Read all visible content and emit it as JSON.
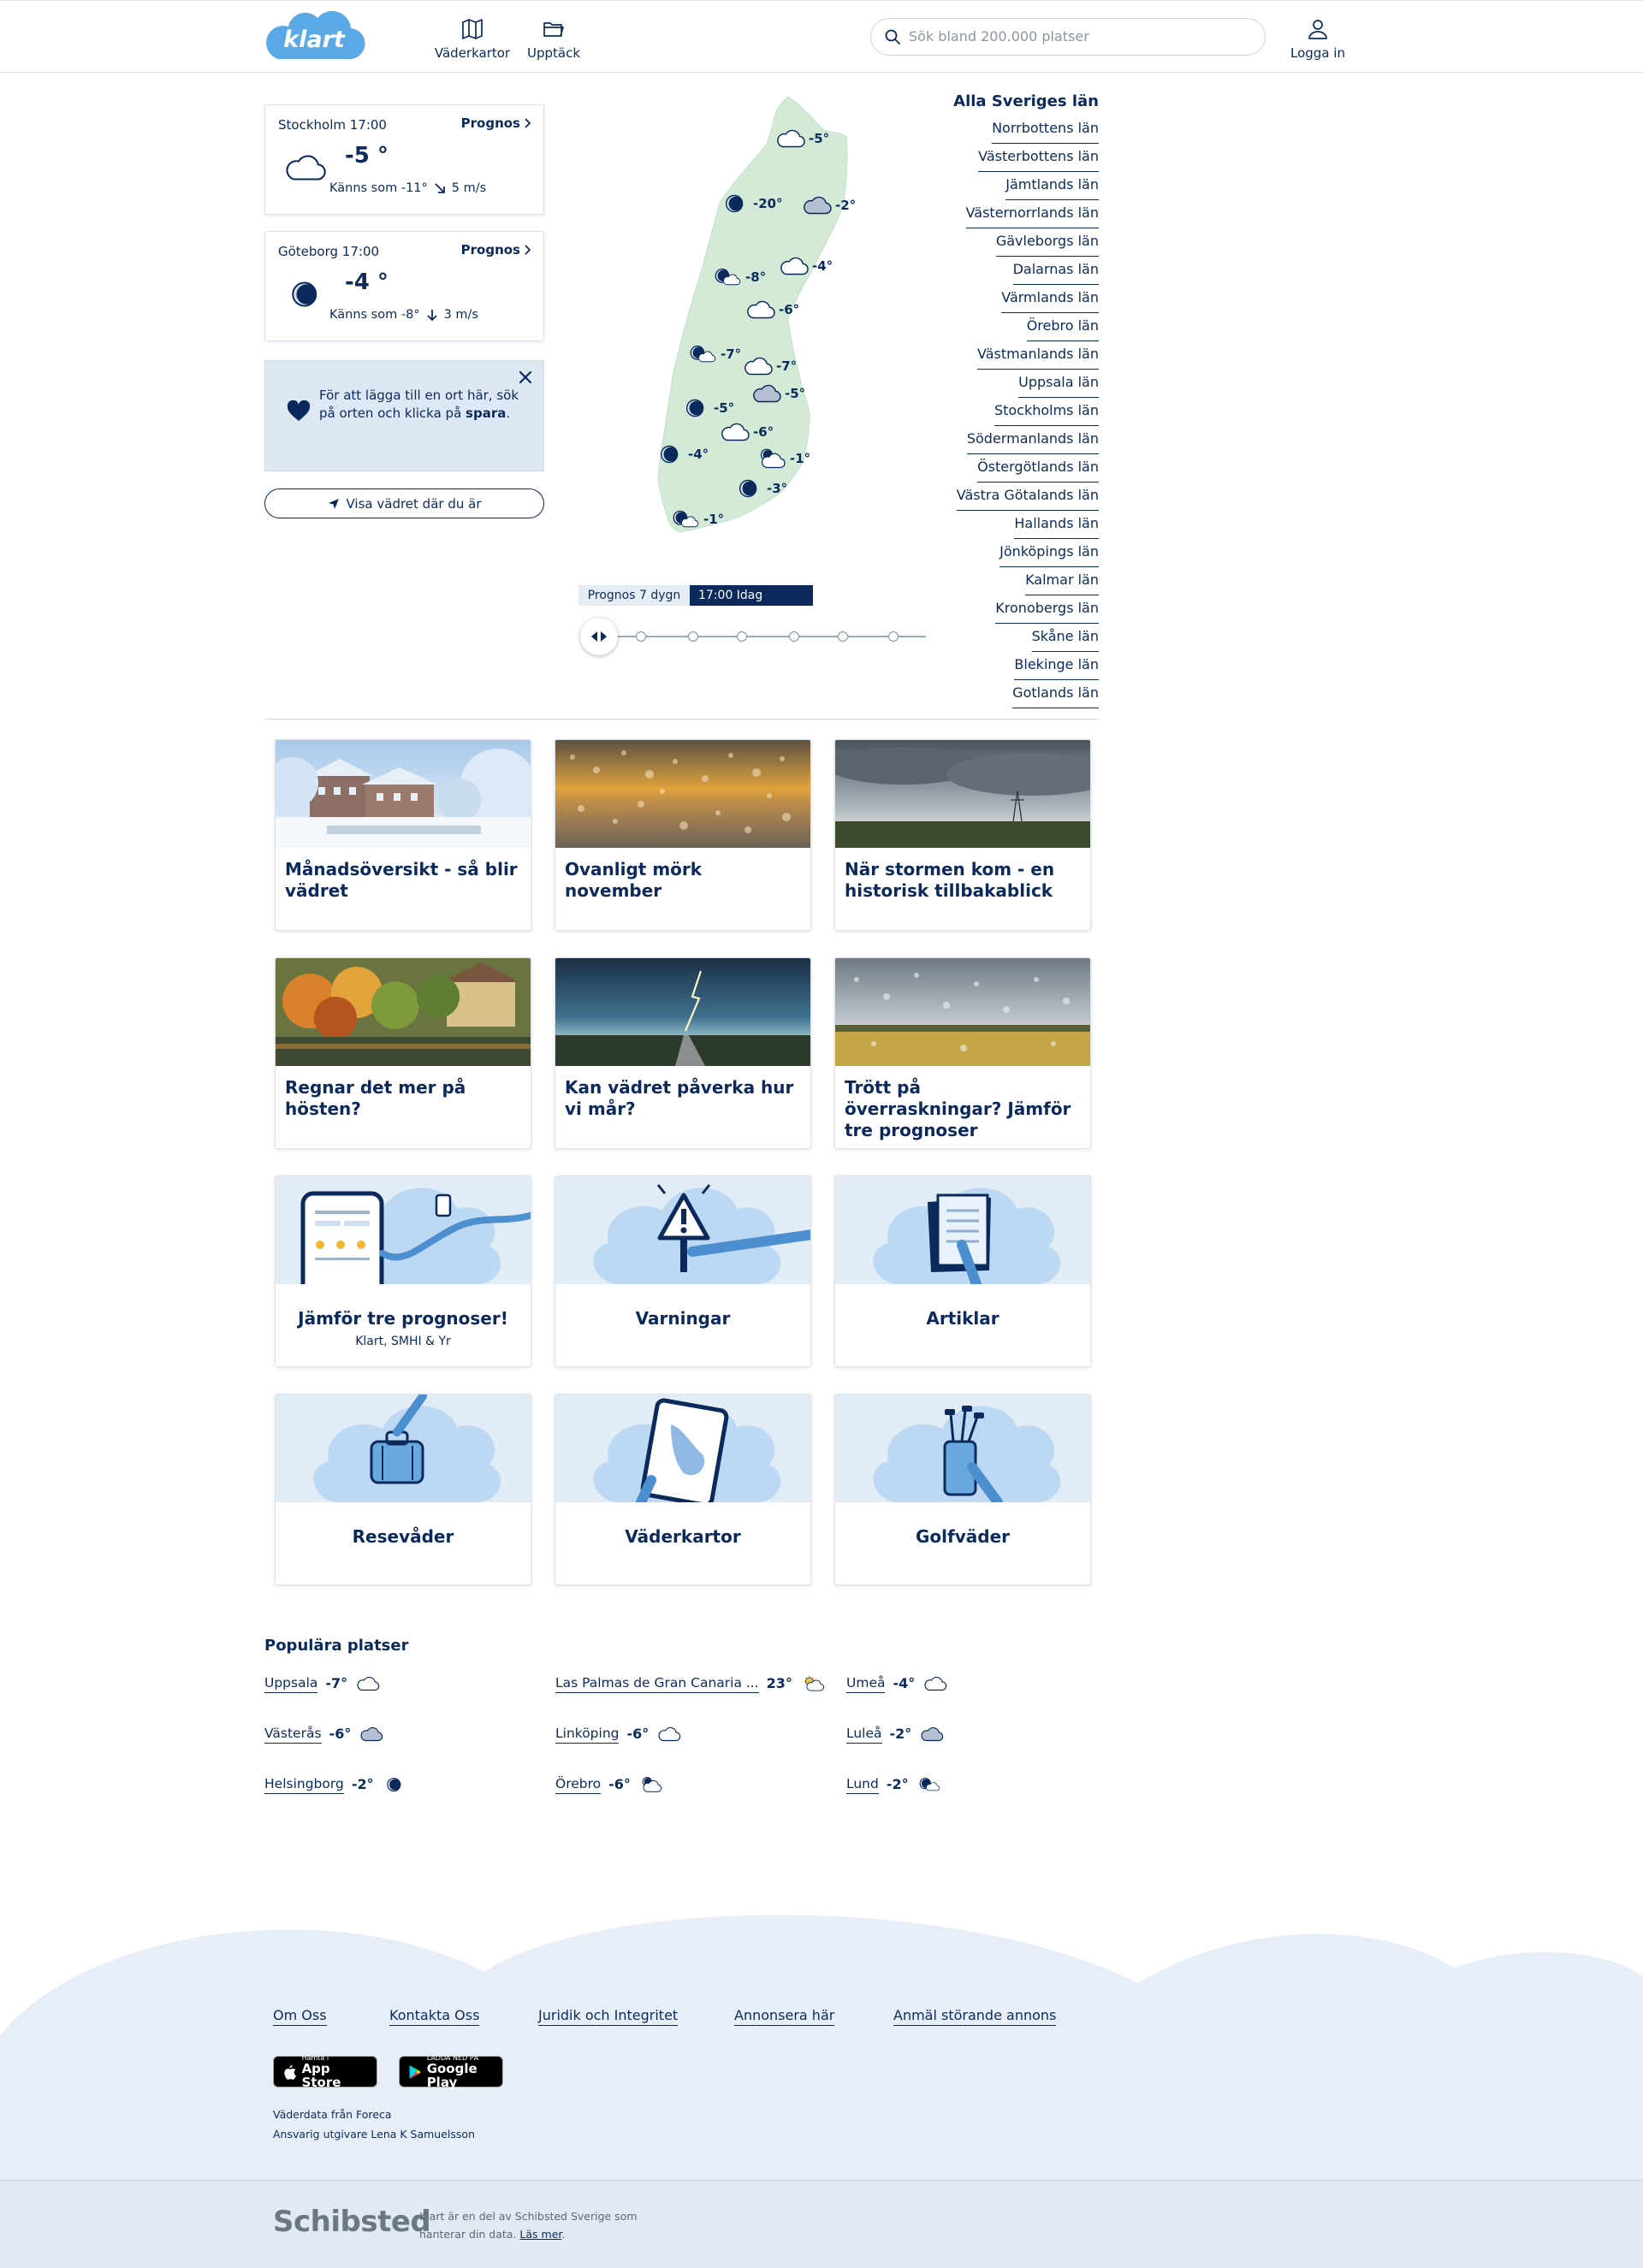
{
  "header": {
    "logo": "klart",
    "nav": [
      {
        "label": "Väderkartor",
        "icon": "map-icon"
      },
      {
        "label": "Upptäck",
        "icon": "folder-icon"
      }
    ],
    "search_placeholder": "Sök bland 200.000 platser",
    "login_label": "Logga in"
  },
  "saved_locations": [
    {
      "title": "Stockholm 17:00",
      "link": "Prognos",
      "temp": "-5 °",
      "icon": "cloud-icon",
      "feels": "Känns som -11°",
      "wind": "5 m/s",
      "wind_icon": "arrow-down-right-icon"
    },
    {
      "title": "Göteborg 17:00",
      "link": "Prognos",
      "temp": "-4 °",
      "icon": "moon-icon",
      "feels": "Känns som -8°",
      "wind": "3 m/s",
      "wind_icon": "arrow-down-icon"
    }
  ],
  "favorite_tip": {
    "text_before": "För att lägga till en ort här, sök på orten och klicka på ",
    "text_bold": "spara",
    "text_after": "."
  },
  "location_button": "Visa vädret där du är",
  "map": {
    "markers": [
      {
        "temp": "-5°",
        "icon": "cloud-icon"
      },
      {
        "temp": "-20°",
        "icon": "moon-icon"
      },
      {
        "temp": "-2°",
        "icon": "cloud-dark-icon"
      },
      {
        "temp": "-4°",
        "icon": "cloud-icon"
      },
      {
        "temp": "-8°",
        "icon": "moon-partly-icon"
      },
      {
        "temp": "-6°",
        "icon": "cloud-icon"
      },
      {
        "temp": "-7°",
        "icon": "moon-partly-icon"
      },
      {
        "temp": "-7°",
        "icon": "cloud-icon"
      },
      {
        "temp": "-5°",
        "icon": "cloud-dark-icon"
      },
      {
        "temp": "-5°",
        "icon": "moon-icon"
      },
      {
        "temp": "-6°",
        "icon": "cloud-icon"
      },
      {
        "temp": "-1°",
        "icon": "moon-cloud-icon"
      },
      {
        "temp": "-4°",
        "icon": "moon-icon"
      },
      {
        "temp": "-3°",
        "icon": "moon-icon"
      },
      {
        "temp": "-1°",
        "icon": "moon-partly-icon"
      }
    ]
  },
  "forecast_timeline": {
    "label": "Prognos 7 dygn",
    "selected": "17:00 Idag",
    "steps": 7,
    "selected_step": 0
  },
  "regions": {
    "title": "Alla Sveriges län",
    "items": [
      "Norrbottens län",
      "Västerbottens län",
      "Jämtlands län",
      "Västernorrlands län",
      "Gävleborgs län",
      "Dalarnas län",
      "Värmlands län",
      "Örebro län",
      "Västmanlands län",
      "Uppsala län",
      "Stockholms län",
      "Södermanlands län",
      "Östergötlands län",
      "Västra Götalands län",
      "Hallands län",
      "Jönköpings län",
      "Kalmar län",
      "Kronobergs län",
      "Skåne län",
      "Blekinge län",
      "Gotlands län"
    ]
  },
  "articles": [
    {
      "title": "Månadsöversikt - så blir vädret",
      "image": "winter-street-photo"
    },
    {
      "title": "Ovanligt mörk november",
      "image": "rain-window-photo"
    },
    {
      "title": "När stormen kom - en historisk tillbakablick",
      "image": "storm-field-photo"
    },
    {
      "title": "Regnar det mer på hösten?",
      "image": "autumn-garden-photo"
    },
    {
      "title": "Kan vädret påverka hur vi mår?",
      "image": "lightning-photo"
    },
    {
      "title": "Trött på överraskningar? Jämför tre prognoser",
      "image": "rain-field-photo"
    }
  ],
  "features": [
    {
      "title": "Jämför tre prognoser!",
      "subtitle": "Klart, SMHI & Yr",
      "illustration": "phone-illustration"
    },
    {
      "title": "Varningar",
      "subtitle": "",
      "illustration": "warning-illustration"
    },
    {
      "title": "Artiklar",
      "subtitle": "",
      "illustration": "articles-illustration"
    },
    {
      "title": "Resevåder",
      "subtitle": "",
      "illustration": "travel-illustration"
    },
    {
      "title": "Väderkartor",
      "subtitle": "",
      "illustration": "map-illustration"
    },
    {
      "title": "Golfväder",
      "subtitle": "",
      "illustration": "golf-illustration"
    }
  ],
  "popular": {
    "title": "Populära platser",
    "items": [
      {
        "name": "Uppsala",
        "temp": "-7°",
        "icon": "cloud-icon"
      },
      {
        "name": "Västerås",
        "temp": "-6°",
        "icon": "cloud-dark-icon"
      },
      {
        "name": "Helsingborg",
        "temp": "-2°",
        "icon": "moon-icon"
      },
      {
        "name": "Las Palmas de Gran Canaria ...",
        "temp": "23°",
        "icon": "sun-cloud-icon"
      },
      {
        "name": "Linköping",
        "temp": "-6°",
        "icon": "cloud-icon"
      },
      {
        "name": "Örebro",
        "temp": "-6°",
        "icon": "moon-cloud-icon"
      },
      {
        "name": "Umeå",
        "temp": "-4°",
        "icon": "cloud-icon"
      },
      {
        "name": "Luleå",
        "temp": "-2°",
        "icon": "cloud-dark-icon"
      },
      {
        "name": "Lund",
        "temp": "-2°",
        "icon": "moon-partly-icon"
      }
    ]
  },
  "footer": {
    "links": [
      "Om Oss",
      "Kontakta Oss",
      "Juridik och Integritet",
      "Annonsera här",
      "Anmäl störande annons"
    ],
    "app_store": {
      "small": "Hämta i",
      "big": "App Store"
    },
    "google_play": {
      "small": "LADDA NED PÅ",
      "big": "Google Play"
    },
    "data_source": "Väderdata från Foreca",
    "publisher": "Ansvarig utgivare Lena K Samuelsson",
    "brand": "Schibsted",
    "about_text": "Klart är en del av Schibsted Sverige som hanterar din data. ",
    "about_link": "Läs mer",
    "about_suffix": "."
  },
  "colors": {
    "navy": "#0b2a5b",
    "logo_blue": "#5aa9e6",
    "map_land": "#d2ead6",
    "tip_bg": "#dde8f4",
    "footer_bg": "#e7eef7"
  }
}
